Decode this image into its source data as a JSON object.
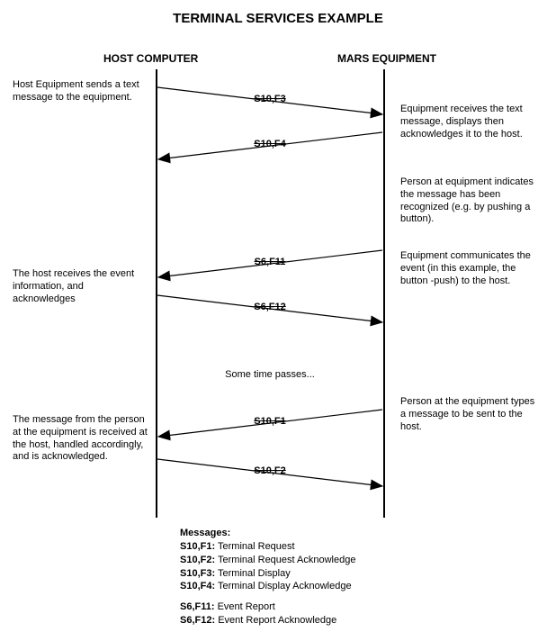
{
  "title": "TERMINAL SERVICES EXAMPLE",
  "columns": {
    "left": "HOST COMPUTER",
    "right": "MARS EQUIPMENT"
  },
  "notes": {
    "left1": "Host Equipment sends a text message to the equipment.",
    "right1": "Equipment receives the text message, displays then acknowledges it to the host.",
    "right2": "Person at equipment indicates the message has been recognized (e.g. by pushing a button).",
    "left2": "The host receives the event information, and acknowledges",
    "right3": "Equipment communicates the event (in this example, the button -push) to the host.",
    "timepass": "Some time passes...",
    "right4": "Person at the equipment types a message to be sent to the host.",
    "left3": "The message from the person at the equipment is received at the host, handled accordingly, and is acknowledged."
  },
  "messages": {
    "m1": "S10,F3",
    "m2": "S10,F4",
    "m3": "S6,F11",
    "m4": "S6,F12",
    "m5": "S10,F1",
    "m6": "S10,F2"
  },
  "legend": {
    "heading": "Messages:",
    "l1a": "S10,F1:",
    "l1b": " Terminal Request",
    "l2a": "S10,F2:",
    "l2b": " Terminal Request Acknowledge",
    "l3a": "S10,F3:",
    "l3b": " Terminal Display",
    "l4a": "S10,F4:",
    "l4b": " Terminal Display Acknowledge",
    "l5a": "S6,F11:",
    "l5b": " Event Report",
    "l6a": "S6,F12:",
    "l6b": " Event Report Acknowledge"
  }
}
